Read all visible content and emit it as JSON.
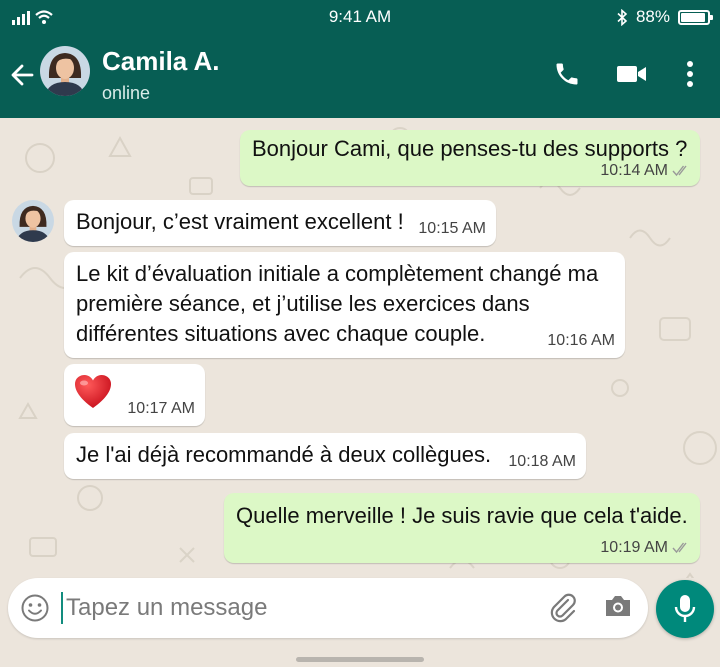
{
  "status_bar": {
    "time": "9:41 AM",
    "battery": "88%"
  },
  "header": {
    "contact_name": "Camila A.",
    "contact_status": "online"
  },
  "messages": [
    {
      "direction": "outgoing",
      "text": "Bonjour Cami, que penses-tu des supports ?",
      "time": "10:14 AM",
      "read": true
    },
    {
      "direction": "incoming",
      "text": "Bonjour, c’est vraiment excellent !",
      "time": "10:15 AM"
    },
    {
      "direction": "incoming",
      "lines": [
        "Le kit d’évaluation initiale a complètement changé ma",
        "première séance, et j’utilise les exercices dans",
        "différentes situations avec chaque couple."
      ],
      "time": "10:16 AM"
    },
    {
      "direction": "incoming",
      "emoji": "heart",
      "time": "10:17 AM"
    },
    {
      "direction": "incoming",
      "text": "Je l'ai déjà recommandé à deux collègues.",
      "time": "10:18 AM"
    },
    {
      "direction": "outgoing",
      "text": "Quelle merveille ! Je suis ravie que cela t'aide.",
      "time": "10:19 AM",
      "read": true
    }
  ],
  "composer": {
    "placeholder": "Tapez un message"
  },
  "icons": {
    "back": "arrow-left-icon",
    "call": "phone-icon",
    "video": "video-camera-icon",
    "menu": "more-vertical-icon",
    "emoji": "emoji-icon",
    "attach": "paperclip-icon",
    "camera": "camera-icon",
    "mic": "microphone-icon"
  },
  "colors": {
    "header": "#075e54",
    "outgoing_bubble": "#dcf8c6",
    "incoming_bubble": "#ffffff",
    "accent": "#00897b",
    "chat_bg": "#ece5dc"
  }
}
